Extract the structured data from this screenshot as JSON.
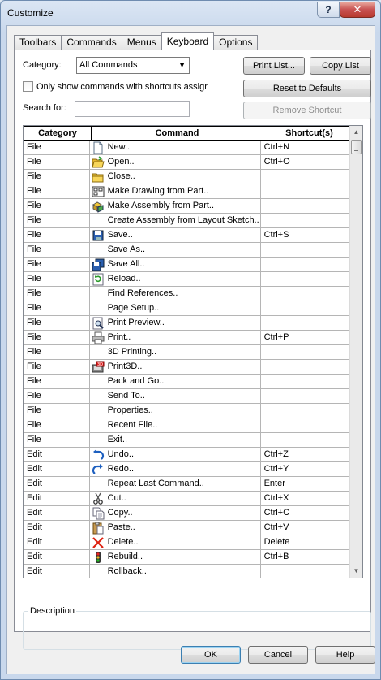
{
  "window": {
    "title": "Customize",
    "help": "?",
    "close": "✕"
  },
  "tabs": [
    {
      "label": "Toolbars",
      "active": false
    },
    {
      "label": "Commands",
      "active": false
    },
    {
      "label": "Menus",
      "active": false
    },
    {
      "label": "Keyboard",
      "active": true
    },
    {
      "label": "Options",
      "active": false
    }
  ],
  "filters": {
    "category_label": "Category:",
    "category_value": "All Commands",
    "shortcut_only_label": "Only show commands with shortcuts assigr",
    "shortcut_only_checked": false,
    "search_label": "Search for:",
    "search_value": ""
  },
  "buttons": {
    "print_list": "Print List...",
    "copy_list": "Copy List",
    "reset_defaults": "Reset to Defaults",
    "remove_shortcut": "Remove Shortcut",
    "ok": "OK",
    "cancel": "Cancel",
    "help": "Help"
  },
  "table": {
    "columns": [
      "Category",
      "Command",
      "Shortcut(s)"
    ],
    "rows": [
      {
        "category": "File",
        "command": "New..",
        "shortcut": "Ctrl+N",
        "icon": "new-document-icon"
      },
      {
        "category": "File",
        "command": "Open..",
        "shortcut": "Ctrl+O",
        "icon": "open-folder-icon"
      },
      {
        "category": "File",
        "command": "Close..",
        "shortcut": "",
        "icon": "close-folder-icon"
      },
      {
        "category": "File",
        "command": "Make Drawing from Part..",
        "shortcut": "",
        "icon": "make-drawing-icon"
      },
      {
        "category": "File",
        "command": "Make Assembly from Part..",
        "shortcut": "",
        "icon": "make-assembly-icon"
      },
      {
        "category": "File",
        "command": "Create Assembly from Layout Sketch..",
        "shortcut": "",
        "icon": ""
      },
      {
        "category": "File",
        "command": "Save..",
        "shortcut": "Ctrl+S",
        "icon": "save-icon"
      },
      {
        "category": "File",
        "command": "Save As..",
        "shortcut": "",
        "icon": ""
      },
      {
        "category": "File",
        "command": "Save All..",
        "shortcut": "",
        "icon": "save-all-icon"
      },
      {
        "category": "File",
        "command": "Reload..",
        "shortcut": "",
        "icon": "reload-icon"
      },
      {
        "category": "File",
        "command": "Find References..",
        "shortcut": "",
        "icon": ""
      },
      {
        "category": "File",
        "command": "Page Setup..",
        "shortcut": "",
        "icon": ""
      },
      {
        "category": "File",
        "command": "Print Preview..",
        "shortcut": "",
        "icon": "print-preview-icon"
      },
      {
        "category": "File",
        "command": "Print..",
        "shortcut": "Ctrl+P",
        "icon": "printer-icon"
      },
      {
        "category": "File",
        "command": "3D Printing..",
        "shortcut": "",
        "icon": ""
      },
      {
        "category": "File",
        "command": "Print3D..",
        "shortcut": "",
        "icon": "print3d-icon"
      },
      {
        "category": "File",
        "command": "Pack and Go..",
        "shortcut": "",
        "icon": ""
      },
      {
        "category": "File",
        "command": "Send To..",
        "shortcut": "",
        "icon": ""
      },
      {
        "category": "File",
        "command": "Properties..",
        "shortcut": "",
        "icon": ""
      },
      {
        "category": "File",
        "command": "Recent File..",
        "shortcut": "",
        "icon": ""
      },
      {
        "category": "File",
        "command": "Exit..",
        "shortcut": "",
        "icon": ""
      },
      {
        "category": "Edit",
        "command": "Undo..",
        "shortcut": "Ctrl+Z",
        "icon": "undo-icon"
      },
      {
        "category": "Edit",
        "command": "Redo..",
        "shortcut": "Ctrl+Y",
        "icon": "redo-icon"
      },
      {
        "category": "Edit",
        "command": "Repeat Last Command..",
        "shortcut": "Enter",
        "icon": ""
      },
      {
        "category": "Edit",
        "command": "Cut..",
        "shortcut": "Ctrl+X",
        "icon": "scissors-icon"
      },
      {
        "category": "Edit",
        "command": "Copy..",
        "shortcut": "Ctrl+C",
        "icon": "copy-icon"
      },
      {
        "category": "Edit",
        "command": "Paste..",
        "shortcut": "Ctrl+V",
        "icon": "paste-icon"
      },
      {
        "category": "Edit",
        "command": "Delete..",
        "shortcut": "Delete",
        "icon": "delete-x-icon"
      },
      {
        "category": "Edit",
        "command": "Rebuild..",
        "shortcut": "Ctrl+B",
        "icon": "rebuild-traffic-light-icon"
      },
      {
        "category": "Edit",
        "command": "Rollback..",
        "shortcut": "",
        "icon": ""
      }
    ]
  },
  "description": {
    "label": "Description",
    "text": ""
  }
}
